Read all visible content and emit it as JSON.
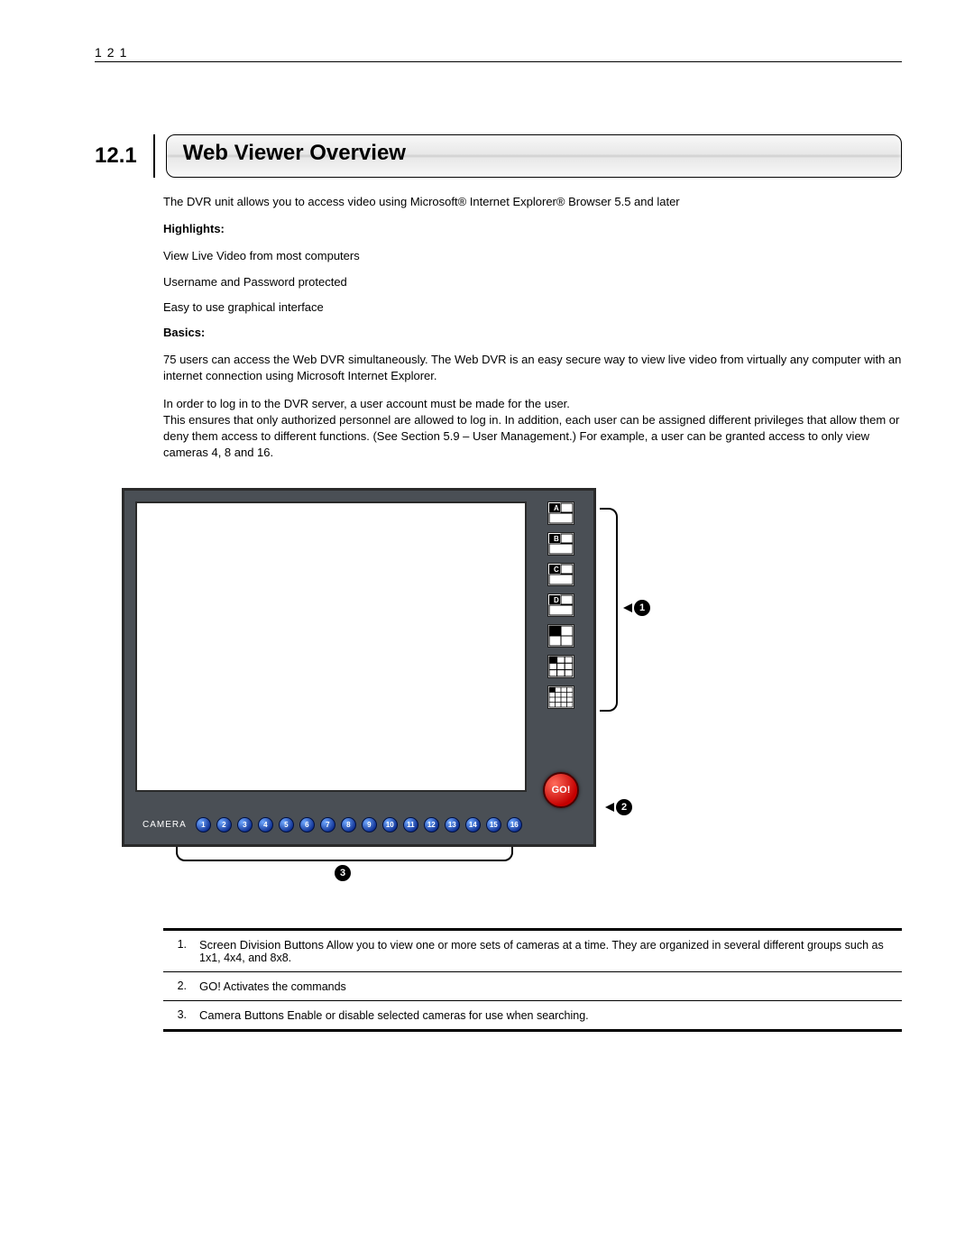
{
  "page_number": "121",
  "section": {
    "number": "12.1",
    "title": "Web Viewer Overview"
  },
  "intro": "The DVR unit allows you to access video using Microsoft® Internet Explorer® Browser 5.5 and later",
  "highlights_label": "Highlights:",
  "highlights": [
    "View Live Video from most computers",
    "Username and Password protected",
    "Easy to use graphical interface"
  ],
  "basics_label": "Basics:",
  "basics_p1": "75 users can access the Web DVR simultaneously. The Web DVR is an easy secure way to view live video from virtually any computer with an internet connection using Microsoft Internet Explorer.",
  "basics_p2": "In order to log in to the DVR server, a user account must be made for the user.",
  "basics_p3": "This ensures that only authorized personnel are allowed to log in.  In addition, each user can be assigned different privileges that allow them or deny them access to different functions.  (See Section 5.9 – User Management.)  For example, a user can be granted access to only view cameras 4, 8 and 16.",
  "viewer": {
    "go_label": "GO!",
    "camera_label": "CAMERA",
    "division_letters": [
      "A",
      "B",
      "C",
      "D"
    ],
    "camera_numbers": [
      "1",
      "2",
      "3",
      "4",
      "5",
      "6",
      "7",
      "8",
      "9",
      "10",
      "11",
      "12",
      "13",
      "14",
      "15",
      "16"
    ]
  },
  "callouts": {
    "c1": "1",
    "c2": "2",
    "c3": "3"
  },
  "legend": [
    {
      "n": "1.",
      "term": "Screen Division Buttons",
      "desc": "Allow you to view one or more sets of cameras at a time.  They are organized in several different groups such as 1x1, 4x4, and 8x8."
    },
    {
      "n": "2.",
      "term": "GO!",
      "desc": "Activates the commands"
    },
    {
      "n": "3.",
      "term": "Camera Buttons",
      "desc": "Enable or disable selected cameras for use when searching."
    }
  ]
}
